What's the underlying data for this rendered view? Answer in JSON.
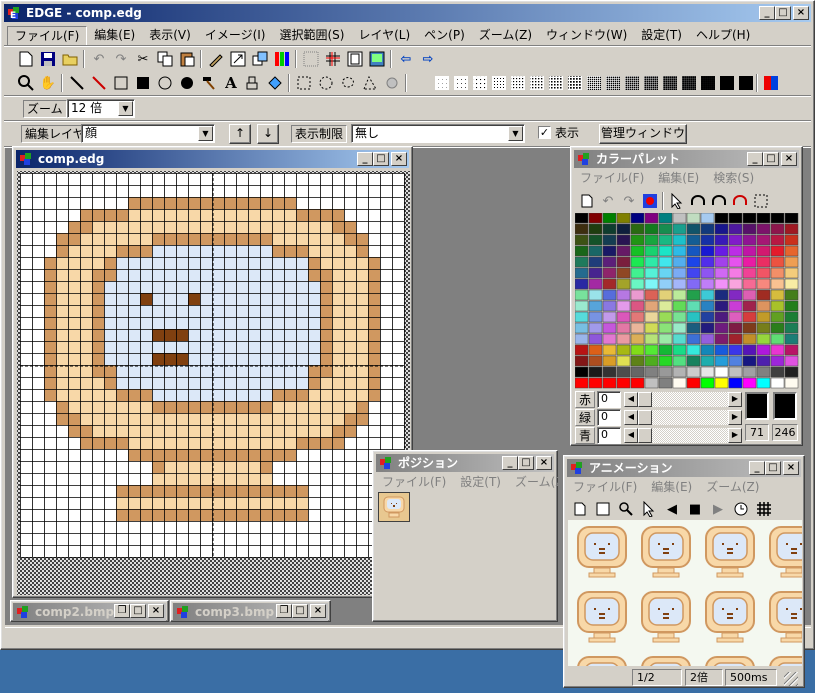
{
  "app": {
    "title": "EDGE - comp.edg"
  },
  "menu": [
    "ファイル(F)",
    "編集(E)",
    "表示(V)",
    "イメージ(I)",
    "選択範囲(S)",
    "レイヤ(L)",
    "ペン(P)",
    "ズーム(Z)",
    "ウィンドウ(W)",
    "設定(T)",
    "ヘルプ(H)"
  ],
  "toolbar": {
    "zoom_label": "ズーム",
    "zoom_value": "12 倍",
    "layer_label": "編集レイヤ",
    "layer_value": "顔",
    "up_arrow": "↑",
    "down_arrow": "↓",
    "limit_label": "表示制限",
    "limit_value": "無し",
    "show_label": "表示",
    "manage_button": "管理ウィンドウ"
  },
  "canvas_window": {
    "title": "comp.edg"
  },
  "minimized": [
    {
      "title": "comp2.bmp"
    },
    {
      "title": "comp3.bmp"
    }
  ],
  "palette": {
    "title": "カラーパレット",
    "menu": [
      "ファイル(F)",
      "編集(E)",
      "検索(S)"
    ],
    "channels": [
      {
        "label": "赤",
        "value": "0"
      },
      {
        "label": "緑",
        "value": "0"
      },
      {
        "label": "青",
        "value": "0"
      }
    ],
    "index_a": "71",
    "index_b": "246"
  },
  "position": {
    "title": "ポジション",
    "menu": [
      "ファイル(F)",
      "設定(T)",
      "ズーム(Z)"
    ]
  },
  "animation": {
    "title": "アニメーション",
    "menu": [
      "ファイル(F)",
      "編集(E)",
      "ズーム(Z)"
    ],
    "status": {
      "frame": "1/2",
      "zoom": "2倍",
      "delay": "500ms"
    }
  },
  "colors": {
    "active_title": "#0a246a",
    "face_fill": "#dce8f8",
    "rim_light": "#f8d8a8",
    "rim_dark": "#d09860",
    "feature": "#804010"
  }
}
